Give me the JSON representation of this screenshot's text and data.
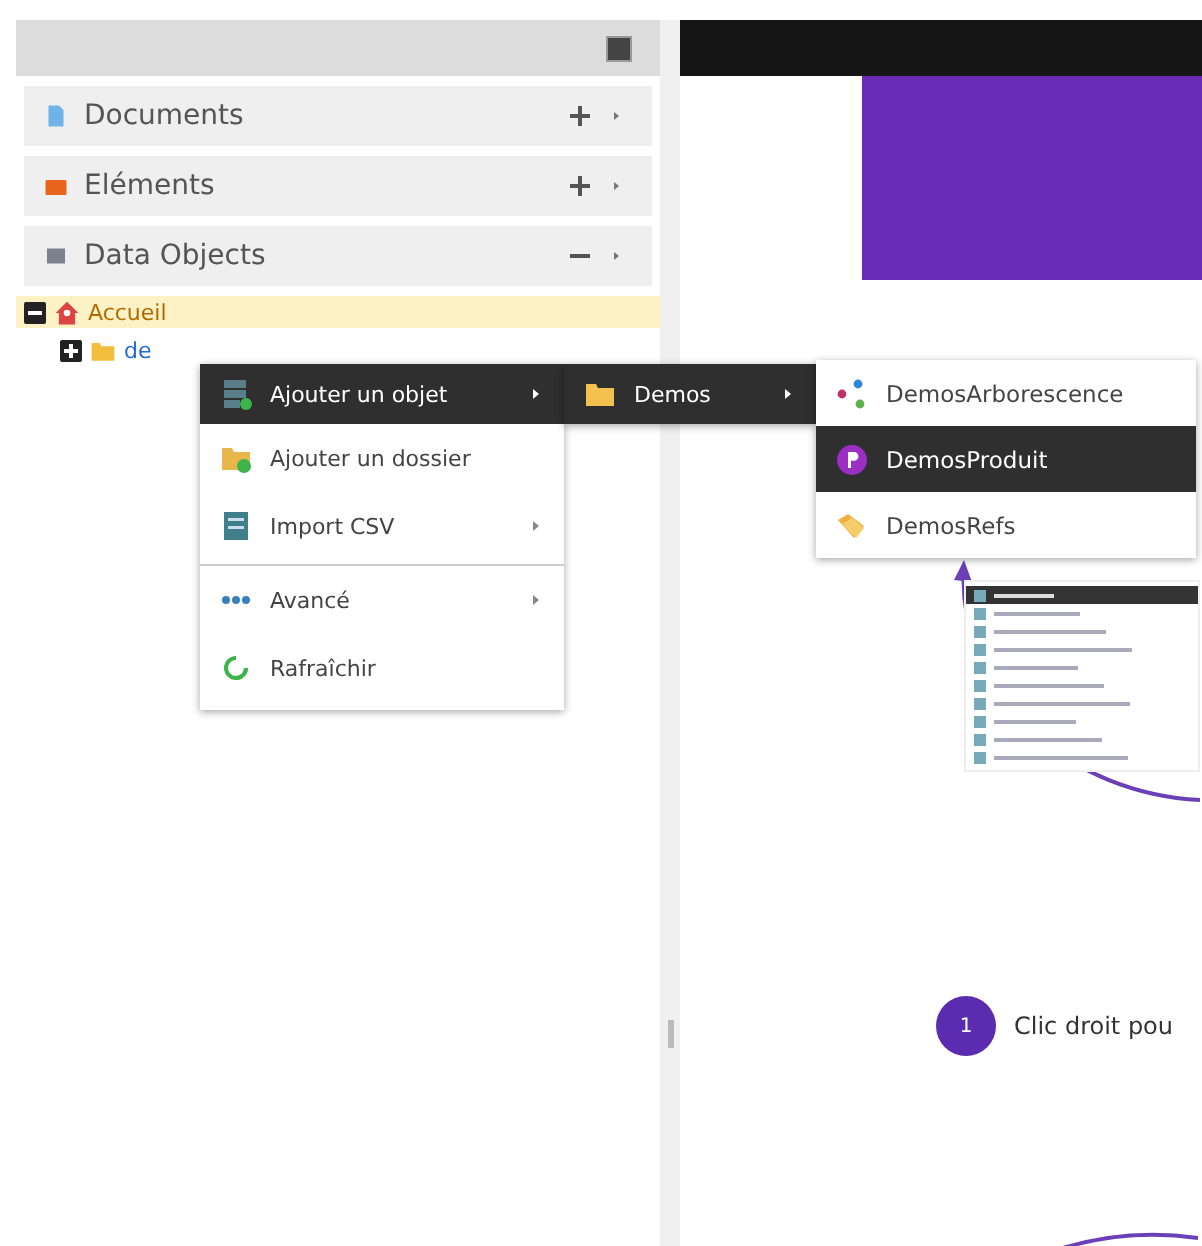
{
  "sidebar": {
    "sections": [
      {
        "label": "Documents",
        "kind": "documents",
        "expanded": false
      },
      {
        "label": "Eléments",
        "kind": "elements",
        "expanded": false
      },
      {
        "label": "Data Objects",
        "kind": "data",
        "expanded": true
      }
    ],
    "tree": [
      {
        "label": "Accueil",
        "kind": "home",
        "expanded": true,
        "children": [
          {
            "label": "de",
            "kind": "folder",
            "expanded": false
          }
        ]
      }
    ]
  },
  "context_menu": [
    {
      "label": "Ajouter un objet",
      "kind": "add-object",
      "submenu": true,
      "selected": true
    },
    {
      "label": "Ajouter un dossier",
      "kind": "add-folder",
      "submenu": false,
      "selected": false
    },
    {
      "label": "Import CSV",
      "kind": "csv",
      "submenu": true,
      "selected": false
    },
    {
      "label": "Avancé",
      "kind": "dots",
      "submenu": true,
      "selected": false,
      "separator_before": true
    },
    {
      "label": "Rafraîchir",
      "kind": "refresh",
      "submenu": false,
      "selected": false
    }
  ],
  "submenu": [
    {
      "label": "Demos",
      "kind": "folder",
      "submenu": true,
      "selected": true
    }
  ],
  "submenu_2": [
    {
      "label": "DemosArborescence",
      "kind": "tree",
      "selected": false
    },
    {
      "label": "DemosProduit",
      "kind": "product",
      "selected": true
    },
    {
      "label": "DemosRefs",
      "kind": "tags",
      "selected": false
    }
  ],
  "content": {
    "step": {
      "number": "1",
      "text": "Clic droit pou"
    }
  }
}
